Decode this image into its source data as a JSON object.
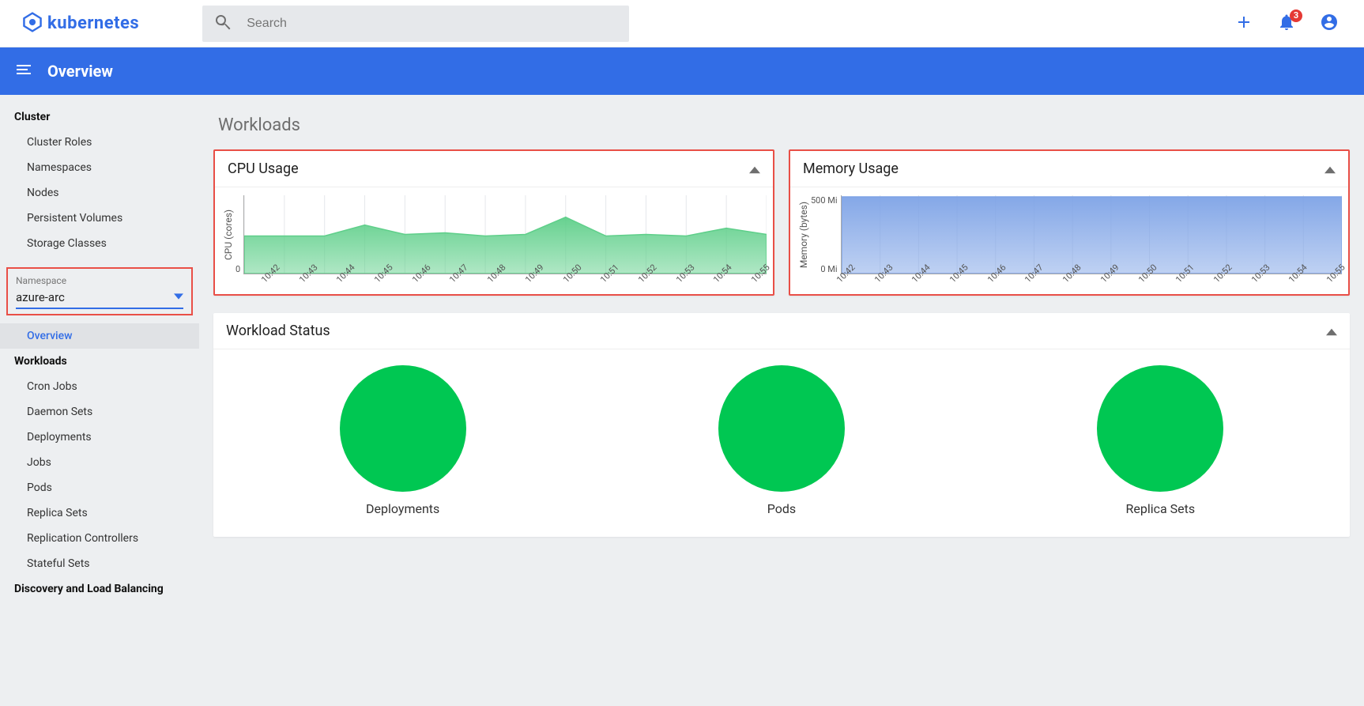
{
  "brand": {
    "name": "kubernetes"
  },
  "search": {
    "placeholder": "Search"
  },
  "topbar": {
    "notification_count": "3"
  },
  "bluebar": {
    "title": "Overview"
  },
  "sidebar": {
    "cluster_title": "Cluster",
    "cluster_items": [
      "Cluster Roles",
      "Namespaces",
      "Nodes",
      "Persistent Volumes",
      "Storage Classes"
    ],
    "namespace_label": "Namespace",
    "namespace_value": "azure-arc",
    "overview": "Overview",
    "workloads_title": "Workloads",
    "workloads_items": [
      "Cron Jobs",
      "Daemon Sets",
      "Deployments",
      "Jobs",
      "Pods",
      "Replica Sets",
      "Replication Controllers",
      "Stateful Sets"
    ],
    "discovery_title": "Discovery and Load Balancing"
  },
  "page": {
    "title": "Workloads"
  },
  "cpu_card_title": "CPU Usage",
  "mem_card_title": "Memory Usage",
  "workload_status_title": "Workload Status",
  "status_labels": {
    "deployments": "Deployments",
    "pods": "Pods",
    "replicasets": "Replica Sets"
  },
  "chart_data": [
    {
      "type": "area",
      "title": "CPU Usage",
      "ylabel": "CPU (cores)",
      "ylim": [
        0,
        1.0
      ],
      "y_ticks": [
        "",
        "0"
      ],
      "categories": [
        "10:42",
        "10:43",
        "10:44",
        "10:45",
        "10:46",
        "10:47",
        "10:48",
        "10:49",
        "10:50",
        "10:51",
        "10:52",
        "10:53",
        "10:54",
        "10:55"
      ],
      "series": [
        {
          "name": "cpu",
          "values": [
            0.48,
            0.48,
            0.48,
            0.62,
            0.5,
            0.52,
            0.48,
            0.5,
            0.72,
            0.48,
            0.5,
            0.48,
            0.58,
            0.5
          ],
          "color": "#5fcf8a"
        }
      ]
    },
    {
      "type": "area",
      "title": "Memory Usage",
      "ylabel": "Memory (bytes)",
      "ylim": [
        0,
        500
      ],
      "y_ticks": [
        "500 Mi",
        "0 Mi"
      ],
      "categories": [
        "10:42",
        "10:43",
        "10:44",
        "10:45",
        "10:46",
        "10:47",
        "10:48",
        "10:49",
        "10:50",
        "10:51",
        "10:52",
        "10:53",
        "10:54",
        "10:55"
      ],
      "series": [
        {
          "name": "mem",
          "values": [
            490,
            490,
            490,
            490,
            490,
            490,
            490,
            490,
            490,
            490,
            490,
            490,
            490,
            490
          ],
          "color": "#7ea3e6"
        }
      ]
    }
  ]
}
